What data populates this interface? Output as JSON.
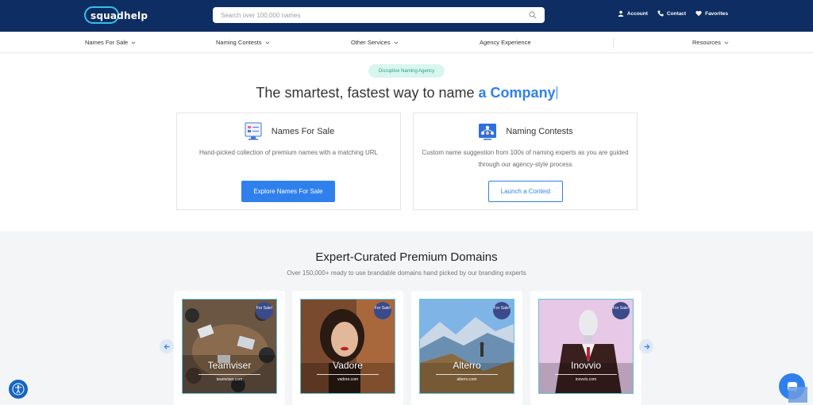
{
  "header": {
    "logo_text": "squadhelp",
    "search_placeholder": "Search over 100,000 names",
    "links": [
      "Account",
      "Contact",
      "Favorites"
    ]
  },
  "nav": {
    "items": [
      "Names For Sale",
      "Naming Contests",
      "Other Services",
      "Agency Experience",
      "Resources"
    ]
  },
  "hero": {
    "badge": "Disruptive Naming Agency",
    "title_prefix": "The smartest, fastest way to name",
    "title_accent": "a Company"
  },
  "cards": [
    {
      "title": "Names For Sale",
      "description": "Hand-picked collection of premium names with a matching URL",
      "button": "Explore Names For Sale"
    },
    {
      "title": "Naming Contests",
      "description": "Custom name suggestion from 100s of naming experts as you are guided through our agency-style process",
      "button": "Launch a Contest"
    }
  ],
  "domains": {
    "title": "Expert-Curated Premium Domains",
    "subtitle": "Over 150,000+ ready to use brandable domains hand picked by our branding experts",
    "for_sale_label": "For Sale!",
    "items": [
      {
        "name": "Teamviser",
        "url": "teamviser.com"
      },
      {
        "name": "Vadore",
        "url": "vadore.com"
      },
      {
        "name": "Alterro",
        "url": "alterro.com"
      },
      {
        "name": "Inovvio",
        "url": "inovvio.com"
      }
    ]
  },
  "colors": {
    "header_bg": "#0e2d63",
    "accent": "#2f80ed",
    "badge_bg": "#d8f6ee",
    "badge_text": "#2ca188"
  }
}
